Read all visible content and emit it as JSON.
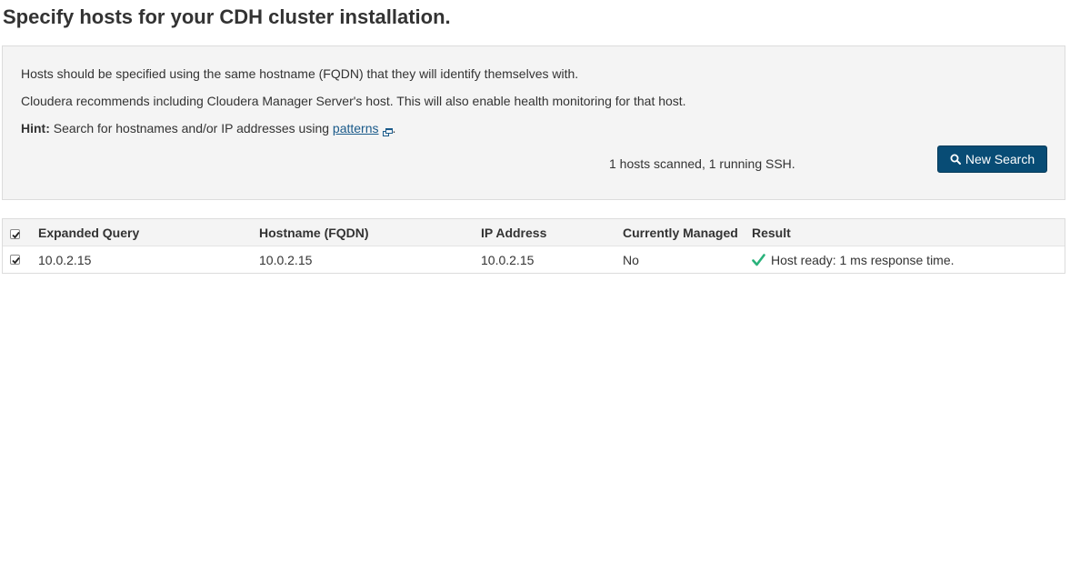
{
  "page": {
    "title": "Specify hosts for your CDH cluster installation."
  },
  "info": {
    "line1": "Hosts should be specified using the same hostname (FQDN) that they will identify themselves with.",
    "line2": "Cloudera recommends including Cloudera Manager Server's host. This will also enable health monitoring for that host.",
    "hint_label": "Hint:",
    "hint_text": " Search for hostnames and/or IP addresses using ",
    "hint_link": "patterns",
    "hint_end": ".",
    "scan_status": "1 hosts scanned, 1 running SSH.",
    "new_search_label": "New Search"
  },
  "table": {
    "columns": [
      "Expanded Query",
      "Hostname (FQDN)",
      "IP Address",
      "Currently Managed",
      "Result"
    ],
    "rows": [
      {
        "checked": true,
        "expanded_query": "10.0.2.15",
        "hostname": "10.0.2.15",
        "ip_address": "10.0.2.15",
        "currently_managed": "No",
        "result": "Host ready: 1 ms response time."
      }
    ],
    "select_all_checked": true
  },
  "colors": {
    "button_bg": "#084c75",
    "success_check": "#2ab27b",
    "link": "#1a5a8a"
  },
  "icons": {
    "search": "search-icon",
    "external_link": "external-link-icon",
    "checkmark": "checkmark-icon",
    "checkbox": "checkbox-icon"
  }
}
